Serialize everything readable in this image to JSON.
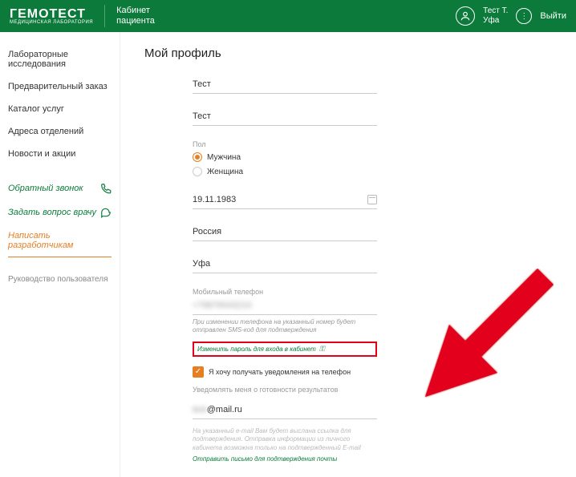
{
  "header": {
    "logo": "ГЕМОТЕСТ",
    "logo_sub": "МЕДИЦИНСКАЯ ЛАБОРАТОРИЯ",
    "section_line1": "Кабинет",
    "section_line2": "пациента",
    "user_name": "Тест Т.",
    "user_city": "Уфа",
    "logout": "Выйти"
  },
  "sidebar": {
    "items": [
      "Лабораторные исследования",
      "Предварительный заказ",
      "Каталог услуг",
      "Адреса отделений",
      "Новости и акции"
    ],
    "callback": "Обратный звонок",
    "ask_doctor": "Задать вопрос врачу",
    "write_devs": "Написать разработчикам",
    "manual": "Руководство пользователя"
  },
  "main": {
    "title": "Мой профиль",
    "first_name": "Тест",
    "last_name": "Тест",
    "gender_label": "Пол",
    "gender_male": "Мужчина",
    "gender_female": "Женщина",
    "dob": "19.11.1983",
    "country": "Россия",
    "city": "Уфа",
    "phone_label": "Мобильный телефон",
    "phone_value": "+79876543210",
    "phone_hint": "При изменении телефона на указанный номер будет отправлен SMS-код для подтверждения",
    "change_password": "Изменить пароль для входа в кабинет",
    "checkbox_text": "Я хочу получать уведомления на телефон",
    "notify_label": "Уведомлять меня о готовности результатов",
    "email_blur": "test",
    "email_domain": "@mail.ru",
    "email_hint": "На указанный e-mail Вам будет выслана ссылка для подтверждения. Отправка информации из личного кабинета возможна только на подтвержденный E-mail",
    "resend": "Отправить письмо для подтверждения почты"
  }
}
